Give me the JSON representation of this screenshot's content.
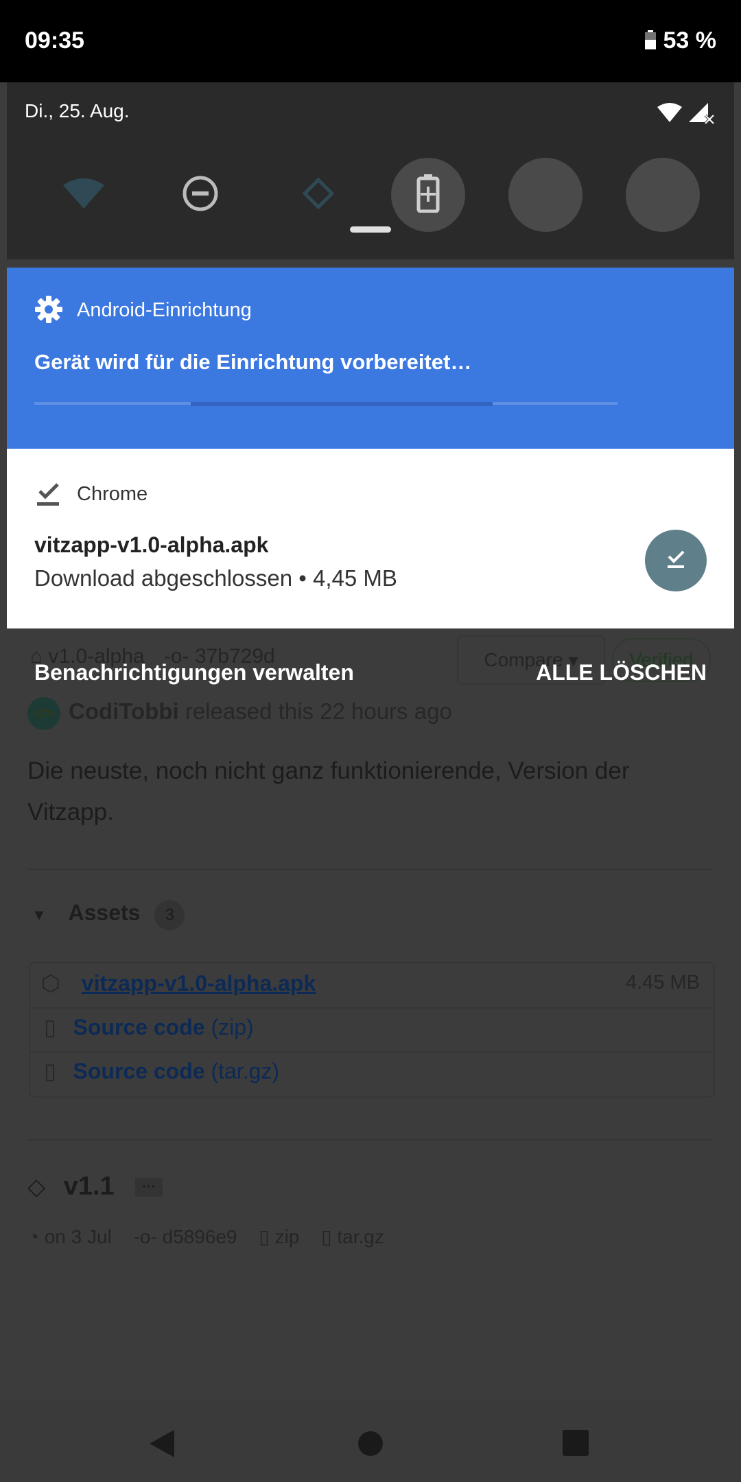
{
  "status_bar": {
    "time": "09:35",
    "battery": "53 %"
  },
  "quick_settings": {
    "date": "Di., 25. Aug."
  },
  "notifications": {
    "setup": {
      "app_name": "Android-Einrichtung",
      "title": "Gerät wird für die Einrichtung vorbereitet…"
    },
    "chrome": {
      "app_name": "Chrome",
      "title": "vitzapp-v1.0-alpha.apk",
      "subtitle": "Download abgeschlossen • 4,45 MB"
    }
  },
  "footer": {
    "manage_label": "Benachrichtigungen verwalten",
    "clear_all_label": "ALLE LÖSCHEN"
  },
  "background_page": {
    "release": {
      "tag": "v1.0-alpha",
      "commit": "37b729d",
      "compare_label": "Compare",
      "verified_label": "Verified",
      "author": "CodiTobbi",
      "released_text": "released this 22 hours ago",
      "description_line1": "Die neuste, noch nicht ganz funktionierende, Version der",
      "description_line2": "Vitzapp.",
      "assets_label": "Assets",
      "assets_count": "3",
      "assets": [
        {
          "name": "vitzapp-v1.0-alpha.apk",
          "size": "4.45 MB"
        },
        {
          "name": "Source code",
          "ext": "(zip)"
        },
        {
          "name": "Source code",
          "ext": "(tar.gz)"
        }
      ]
    },
    "next_release": {
      "tag": "v1.1",
      "more_label": "···",
      "date": "on 3 Jul",
      "commit": "d5896e9",
      "zip_label": "zip",
      "targz_label": "tar.gz"
    }
  },
  "colors": {
    "setup_notification_bg": "#3b78e0",
    "download_action_bg": "#5f7f8a",
    "scrim_bg": "#3c3c3c"
  }
}
